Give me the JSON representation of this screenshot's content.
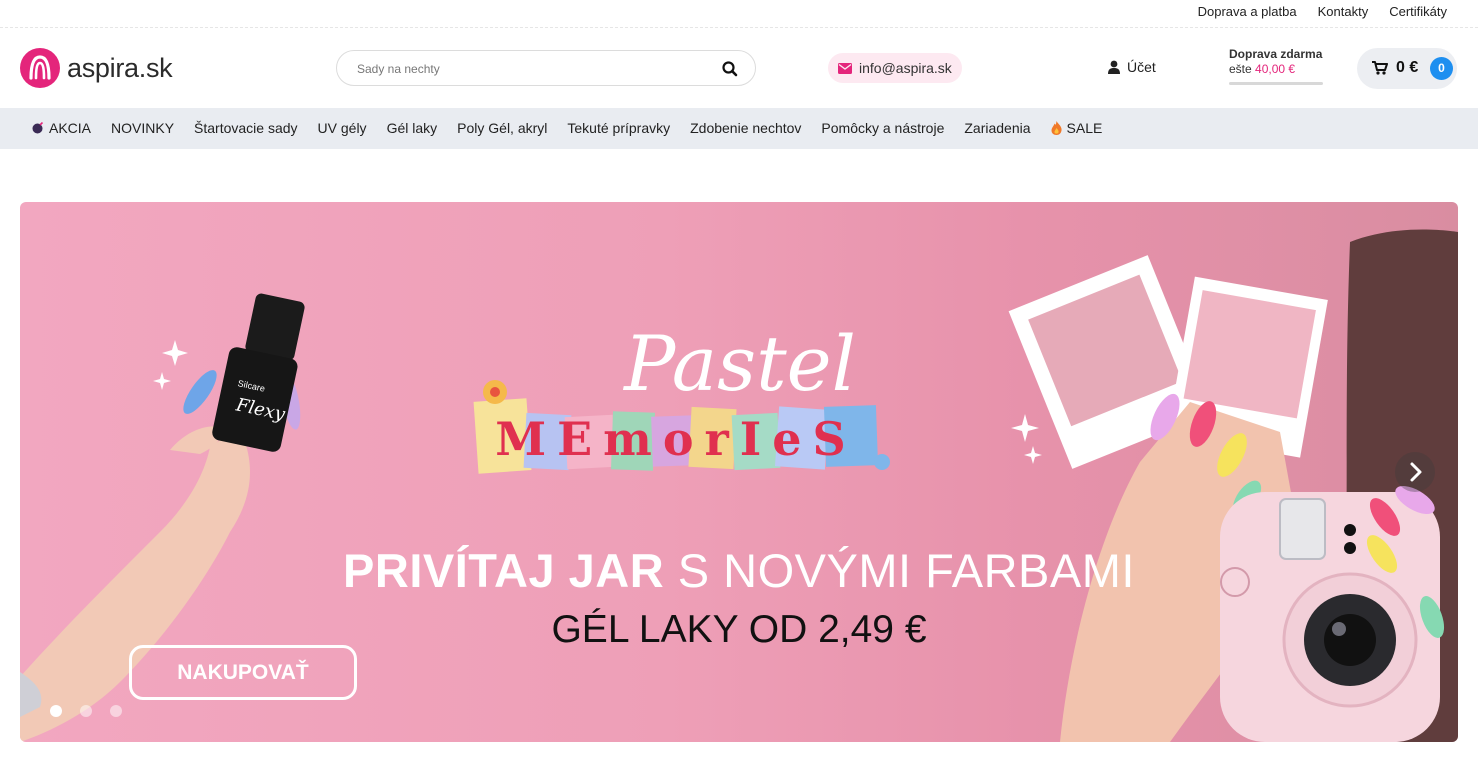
{
  "topbar": {
    "links": [
      "Doprava a platba",
      "Kontakty",
      "Certifikáty"
    ]
  },
  "header": {
    "logo_text": "aspira.sk",
    "search_placeholder": "Sady na nechty",
    "email": "info@aspira.sk",
    "account_label": "Účet",
    "shipping": {
      "title": "Doprava zdarma",
      "prefix": "ešte",
      "amount": "40,00 €",
      "progress": 0
    },
    "cart": {
      "total": "0 €",
      "count": "0"
    }
  },
  "nav": {
    "items": [
      "AKCIA",
      "NOVINKY",
      "Štartovacie sady",
      "UV gély",
      "Gél laky",
      "Poly Gél, akryl",
      "Tekuté prípravky",
      "Zdobenie nechtov",
      "Pomôcky a nástroje",
      "Zariadenia",
      "SALE"
    ]
  },
  "hero": {
    "script_title": "Pastel",
    "letters_title": "MEmorIeS",
    "headline_bold": "PRIVÍTAJ JAR",
    "headline_light": "S NOVÝMI FARBAMI",
    "subline": "GÉL LAKY OD 2,49 €",
    "cta_label": "NAKUPOVAŤ",
    "bottle_brand": "Silcare",
    "bottle_product": "Flexy",
    "slides": 3,
    "active_slide": 1
  },
  "colors": {
    "accent": "#e4257b",
    "nav_bg": "#e9ecf1",
    "cart_badge": "#1e8ff0",
    "hero_bg": "#ee9fb7"
  },
  "icons": {
    "search": "search-icon",
    "email": "envelope-icon",
    "account": "user-icon",
    "cart": "cart-icon",
    "akcia": "bomb-icon",
    "sale": "fire-icon",
    "next": "chevron-right-icon"
  }
}
